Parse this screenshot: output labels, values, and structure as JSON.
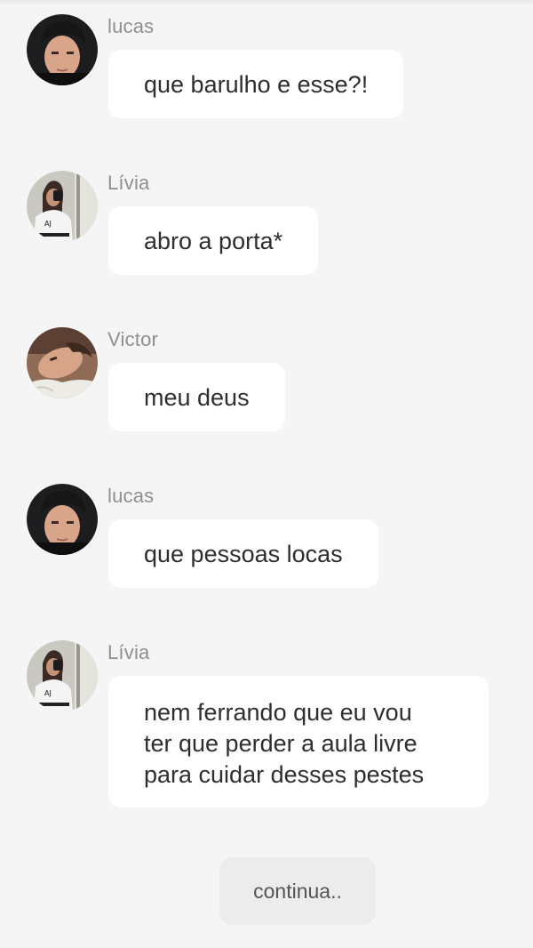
{
  "messages": [
    {
      "sender": "lucas",
      "text": "que barulho e esse?!",
      "avatar": "lucas-avatar"
    },
    {
      "sender": "Lívia",
      "text": "abro a porta*",
      "avatar": "livia-avatar"
    },
    {
      "sender": "Victor",
      "text": "meu deus",
      "avatar": "victor-avatar"
    },
    {
      "sender": "lucas",
      "text": "que pessoas locas",
      "avatar": "lucas-avatar"
    },
    {
      "sender": "Lívia",
      "text": "nem ferrando que eu vou\nter que perder a aula livre\npara cuidar desses pestes",
      "avatar": "livia-avatar"
    }
  ],
  "continue_label": "continua.."
}
